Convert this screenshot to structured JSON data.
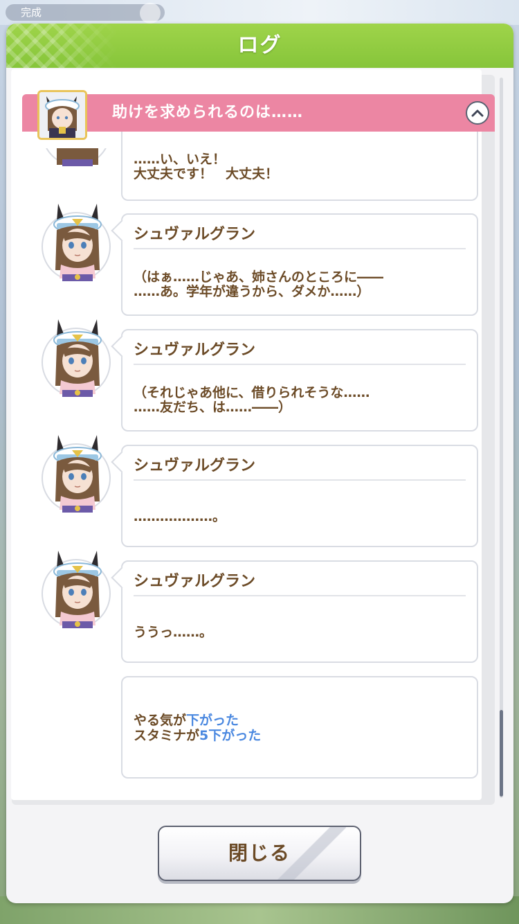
{
  "background": {
    "top_bar_text": "完成"
  },
  "dialog": {
    "title": "ログ",
    "close_label": "閉じる"
  },
  "chapter": {
    "title": "助けを求められるのは……"
  },
  "entries": [
    {
      "speaker": "",
      "text": "……い、いえ！\n大丈夫です！　大丈夫！"
    },
    {
      "speaker": "シュヴァルグラン",
      "text": "（はぁ……じゃあ、姉さんのところに――\n……あ。学年が違うから、ダメか……）"
    },
    {
      "speaker": "シュヴァルグラン",
      "text": "（それじゃあ他に、借りられそうな……\n……友だち、は……――）"
    },
    {
      "speaker": "シュヴァルグラン",
      "text": "………………。"
    },
    {
      "speaker": "シュヴァルグラン",
      "text": "ううっ……。"
    }
  ],
  "result": {
    "line1_prefix": "やる気が",
    "line1_highlight": "下がった",
    "line2_prefix": "スタミナが",
    "line2_highlight": "5下がった"
  },
  "colors": {
    "header_green": "#8ccb3e",
    "banner_pink": "#ec86a3",
    "text_brown": "#6b4a26",
    "highlight_blue": "#4a88e0"
  },
  "icons": {
    "collapse": "chevron-up-icon",
    "avatar": "character-portrait"
  }
}
